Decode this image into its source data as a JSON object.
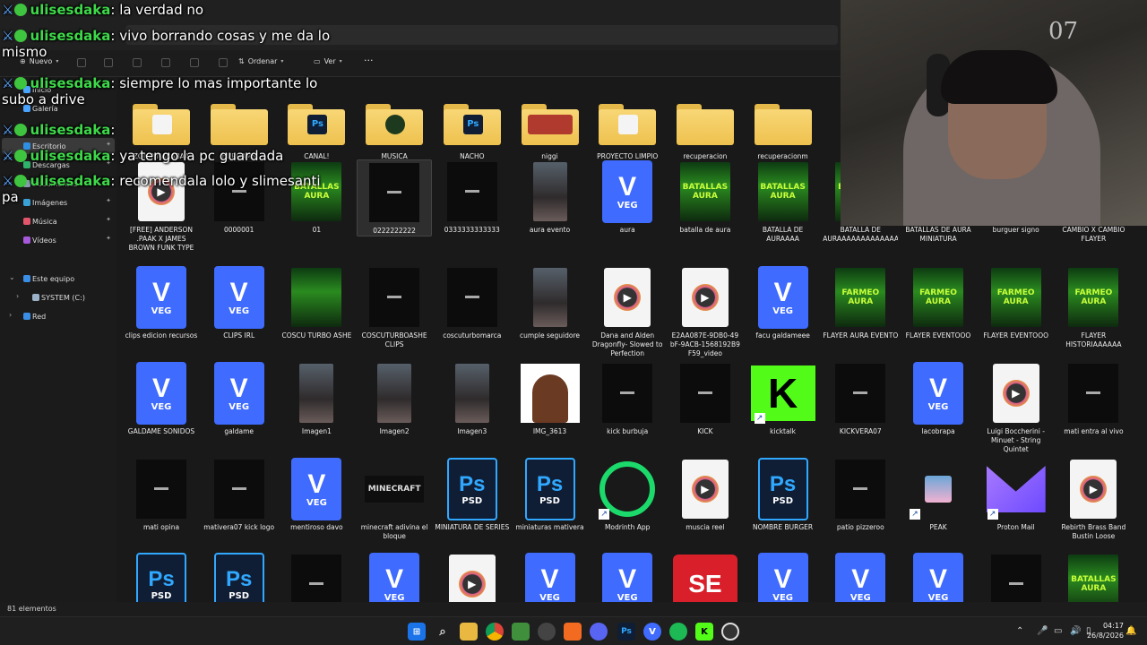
{
  "toolbar": {
    "new": "Nuevo",
    "sort": "Ordenar",
    "view": "Ver",
    "more": "···"
  },
  "sidebar": {
    "items": [
      {
        "label": "Inicio"
      },
      {
        "label": "Galería"
      },
      {
        "label": "Escritorio"
      },
      {
        "label": "Descargas"
      },
      {
        "label": "Documentos"
      },
      {
        "label": "Imágenes"
      },
      {
        "label": "Música"
      },
      {
        "label": "Vídeos"
      }
    ],
    "this_pc": "Este equipo",
    "drive": "SYSTEM (C:)",
    "network": "Red"
  },
  "rows": [
    [
      {
        "name": "ZONAYNABABAA",
        "kind": "folder",
        "inner": "doc"
      },
      {
        "name": "BURGAMS",
        "kind": "folder",
        "inner": ""
      },
      {
        "name": "CANAL!",
        "kind": "folder",
        "inner": "ps"
      },
      {
        "name": "MUSICA",
        "kind": "folder",
        "inner": "music"
      },
      {
        "name": "NACHO",
        "kind": "folder",
        "inner": "ps"
      },
      {
        "name": "niggi",
        "kind": "folder",
        "inner": "img"
      },
      {
        "name": "PROYECTO LIMPIO",
        "kind": "folder",
        "inner": "doc"
      },
      {
        "name": "recuperacion",
        "kind": "folder",
        "inner": ""
      },
      {
        "name": "recuperacionm",
        "kind": "folder",
        "inner": ""
      }
    ],
    [
      {
        "name": "[FREE] ANDERSON .PAAK X JAMES BROWN FUNK TYPE BEAT SHOWMAN",
        "kind": "video"
      },
      {
        "name": "0000001",
        "kind": "dark"
      },
      {
        "name": "01",
        "kind": "poster",
        "text": "BATALLAS AURA"
      },
      {
        "name": "0222222222",
        "kind": "dark",
        "hover": true
      },
      {
        "name": "0333333333333",
        "kind": "dark"
      },
      {
        "name": "aura evento",
        "kind": "photo"
      },
      {
        "name": "aura",
        "kind": "veg"
      },
      {
        "name": "batalla de aura",
        "kind": "poster",
        "text": "BATALLAS AURA"
      },
      {
        "name": "BATALLA DE AURAAAA",
        "kind": "poster",
        "text": "BATALLAS AURA"
      },
      {
        "name": "BATALLA DE AURAAAAAAAAAAAAAAAAAAAAA",
        "kind": "poster",
        "text": "BATALLAS AURA"
      },
      {
        "name": "BATALLAS DE AURA MINIATURA",
        "kind": "poster",
        "text": "BATALLAS AURA"
      },
      {
        "name": "burguer signo",
        "kind": "dark"
      },
      {
        "name": "CAMBIO X CAMBIO FLAYER",
        "kind": "poster",
        "text": "BATALLAS AURA"
      }
    ],
    [
      {
        "name": "clips edicion recursos",
        "kind": "veg"
      },
      {
        "name": "CLIPS IRL",
        "kind": "veg"
      },
      {
        "name": "COSCU TURBO ASHE",
        "kind": "poster",
        "text": ""
      },
      {
        "name": "COSCUTURBOASHE CLIPS",
        "kind": "dark"
      },
      {
        "name": "coscuturbomarca",
        "kind": "dark"
      },
      {
        "name": "cumple seguidore",
        "kind": "photo"
      },
      {
        "name": "Dana and Alden Dragonfly- Slowed to Perfection",
        "kind": "video"
      },
      {
        "name": "E2AA087E-9DB0-49 bF-9ACB-1568192B9 F59_video",
        "kind": "video"
      },
      {
        "name": "facu galdameee",
        "kind": "veg"
      },
      {
        "name": "FLAYER AURA EVENTO",
        "kind": "poster",
        "text": "FARMEO AURA"
      },
      {
        "name": "FLAYER EVENTOOO",
        "kind": "poster",
        "text": "FARMEO AURA"
      },
      {
        "name": "FLAYER EVENTOOO",
        "kind": "poster",
        "text": "FARMEO AURA"
      },
      {
        "name": "FLAYER HISTORIAAAAAA",
        "kind": "poster",
        "text": "FARMEO AURA"
      }
    ],
    [
      {
        "name": "GALDAME SONIDOS",
        "kind": "veg"
      },
      {
        "name": "galdame",
        "kind": "veg"
      },
      {
        "name": "Imagen1",
        "kind": "photo"
      },
      {
        "name": "Imagen2",
        "kind": "photo"
      },
      {
        "name": "Imagen3",
        "kind": "photo"
      },
      {
        "name": "IMG_3613",
        "kind": "avatar"
      },
      {
        "name": "kick burbuja",
        "kind": "dark"
      },
      {
        "name": "KICK",
        "kind": "dark"
      },
      {
        "name": "kicktalk",
        "kind": "kick",
        "shortcut": true
      },
      {
        "name": "KICKVERA07",
        "kind": "dark"
      },
      {
        "name": "lacobrapa",
        "kind": "veg"
      },
      {
        "name": "Luigi Boccherini - Minuet - String Quintet",
        "kind": "video"
      },
      {
        "name": "mati entra al vivo",
        "kind": "dark"
      }
    ],
    [
      {
        "name": "mati opina",
        "kind": "dark"
      },
      {
        "name": "mativera07 kick logo",
        "kind": "dark"
      },
      {
        "name": "mentiroso davo",
        "kind": "veg"
      },
      {
        "name": "minecraft adivina el bloque",
        "kind": "mc"
      },
      {
        "name": "MINIATURA DE SERIES",
        "kind": "psd"
      },
      {
        "name": "miniaturas mativera",
        "kind": "psd"
      },
      {
        "name": "Modrinth App",
        "kind": "modrinth",
        "shortcut": true
      },
      {
        "name": "muscia reel",
        "kind": "video"
      },
      {
        "name": "NOMBRE BURGER",
        "kind": "psd"
      },
      {
        "name": "patio pizzeroo",
        "kind": "dark"
      },
      {
        "name": "PEAK",
        "kind": "peak",
        "shortcut": true
      },
      {
        "name": "Proton Mail",
        "kind": "proton",
        "shortcut": true
      },
      {
        "name": "Rebirth Brass Band Bustin Loose",
        "kind": "video"
      }
    ],
    [
      {
        "name": "",
        "kind": "psd"
      },
      {
        "name": "",
        "kind": "psd"
      },
      {
        "name": "",
        "kind": "dark"
      },
      {
        "name": "",
        "kind": "veg"
      },
      {
        "name": "",
        "kind": "video"
      },
      {
        "name": "",
        "kind": "veg"
      },
      {
        "name": "",
        "kind": "veg"
      },
      {
        "name": "",
        "kind": "se"
      },
      {
        "name": "",
        "kind": "veg"
      },
      {
        "name": "",
        "kind": "veg"
      },
      {
        "name": "",
        "kind": "veg"
      },
      {
        "name": "",
        "kind": "dark"
      },
      {
        "name": "",
        "kind": "poster",
        "text": "BATALLAS AURA"
      }
    ]
  ],
  "status": {
    "count": "81 elementos"
  },
  "clock": {
    "time": "04:17",
    "date": "26/8/2026"
  },
  "webcam": {
    "overlay_text": "07"
  },
  "chat": [
    {
      "user": "ulisesdaka",
      "text": "la verdad no"
    },
    {
      "user": "ulisesdaka",
      "text": "vivo borrando cosas y me da lo mismo"
    },
    {
      "user": "ulisesdaka",
      "text": "siempre lo mas importante lo subo a drive"
    },
    {
      "user": "ulisesdaka",
      "text": ""
    },
    {
      "user": "ulisesdaka",
      "text": "ya tengo la pc guardada"
    },
    {
      "user": "ulisesdaka",
      "text": "recomendala lolo y slimesanti pa"
    }
  ],
  "colors": {
    "veg_blue": "#3f6bff",
    "folder_yellow": "#f8d775",
    "chat_user": "#3ed94a",
    "kick_green": "#53fc18"
  }
}
